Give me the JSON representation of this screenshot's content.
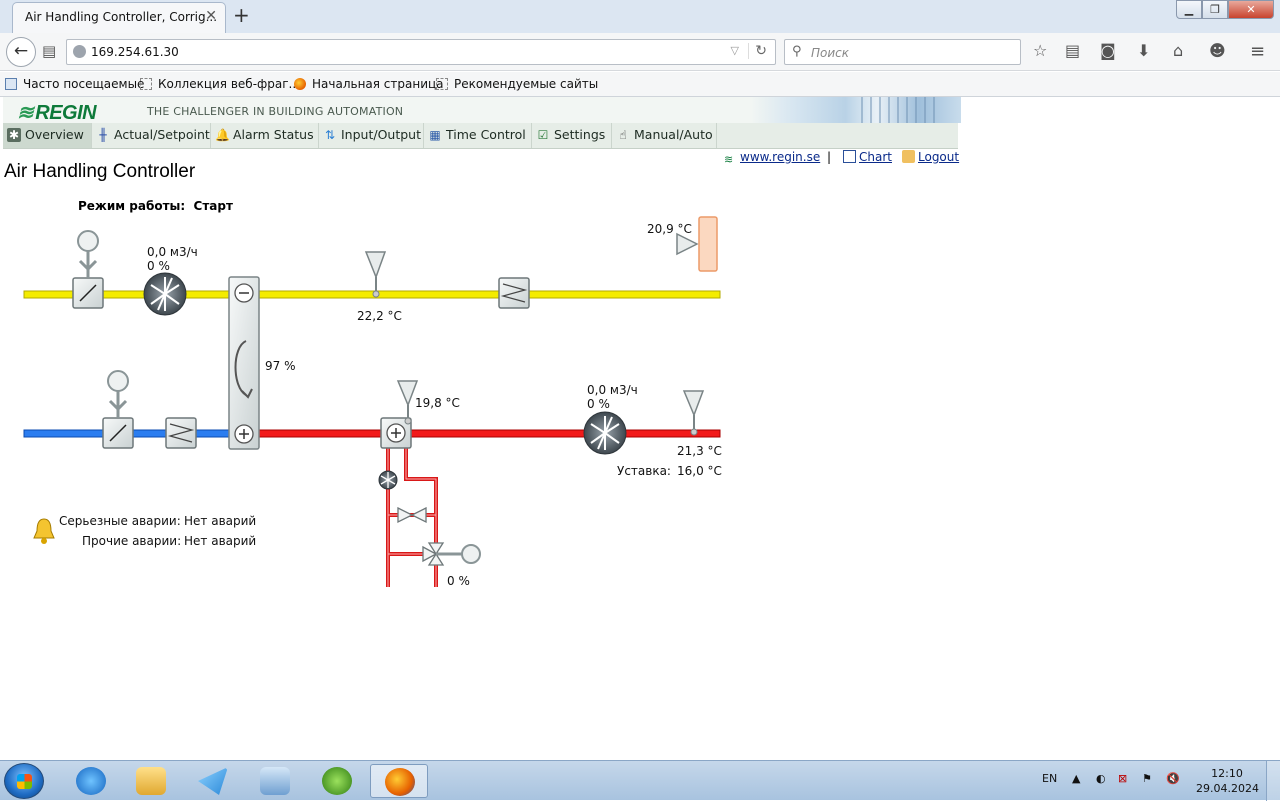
{
  "browser": {
    "tab_title": "Air Handling Controller, Corrig...",
    "url": "169.254.61.30",
    "search_placeholder": "Поиск",
    "bookmarks": [
      "Часто посещаемые",
      "Коллекция веб-фраг...",
      "Начальная страница",
      "Рекомендуемые сайты"
    ]
  },
  "header": {
    "logo": "REGIN",
    "tagline": "THE CHALLENGER IN BUILDING AUTOMATION"
  },
  "menu": [
    {
      "label": "Overview",
      "icon": "fan-icon"
    },
    {
      "label": "Actual/Setpoint",
      "icon": "sliders-icon"
    },
    {
      "label": "Alarm Status",
      "icon": "bell-icon"
    },
    {
      "label": "Input/Output",
      "icon": "arrows-icon"
    },
    {
      "label": "Time Control",
      "icon": "calendar-icon"
    },
    {
      "label": "Settings",
      "icon": "checkbox-icon"
    },
    {
      "label": "Manual/Auto",
      "icon": "hand-icon"
    }
  ],
  "links": {
    "website": "www.regin.se",
    "separator": "|",
    "chart": "Chart",
    "logout": "Logout"
  },
  "page": {
    "title": "Air Handling Controller",
    "mode_label": "Режим работы:",
    "mode_value": "Старт"
  },
  "diagram": {
    "exhaust_fan_flow": "0,0 м3/ч",
    "exhaust_fan_speed": "0 %",
    "extract_temp": "22,2 °C",
    "room_temp": "20,9 °C",
    "heat_recovery": "97 %",
    "after_recovery_temp": "19,8 °C",
    "supply_fan_flow": "0,0 м3/ч",
    "supply_fan_speed": "0 %",
    "supply_temp": "21,3 °C",
    "setpoint_label": "Уставка:",
    "setpoint_value": "16,0 °C",
    "heating_valve": "0 %"
  },
  "alarms": {
    "serious_label": "Серьезные аварии:",
    "serious_value": "Нет аварий",
    "other_label": "Прочие аварии:",
    "other_value": "Нет аварий"
  },
  "taskbar": {
    "lang": "EN",
    "time": "12:10",
    "date": "29.04.2024"
  },
  "colors": {
    "extract_duct": "#e8e000",
    "outdoor_duct": "#1a6fe0",
    "supply_duct": "#e01010",
    "regin_green": "#0e7a3a"
  }
}
